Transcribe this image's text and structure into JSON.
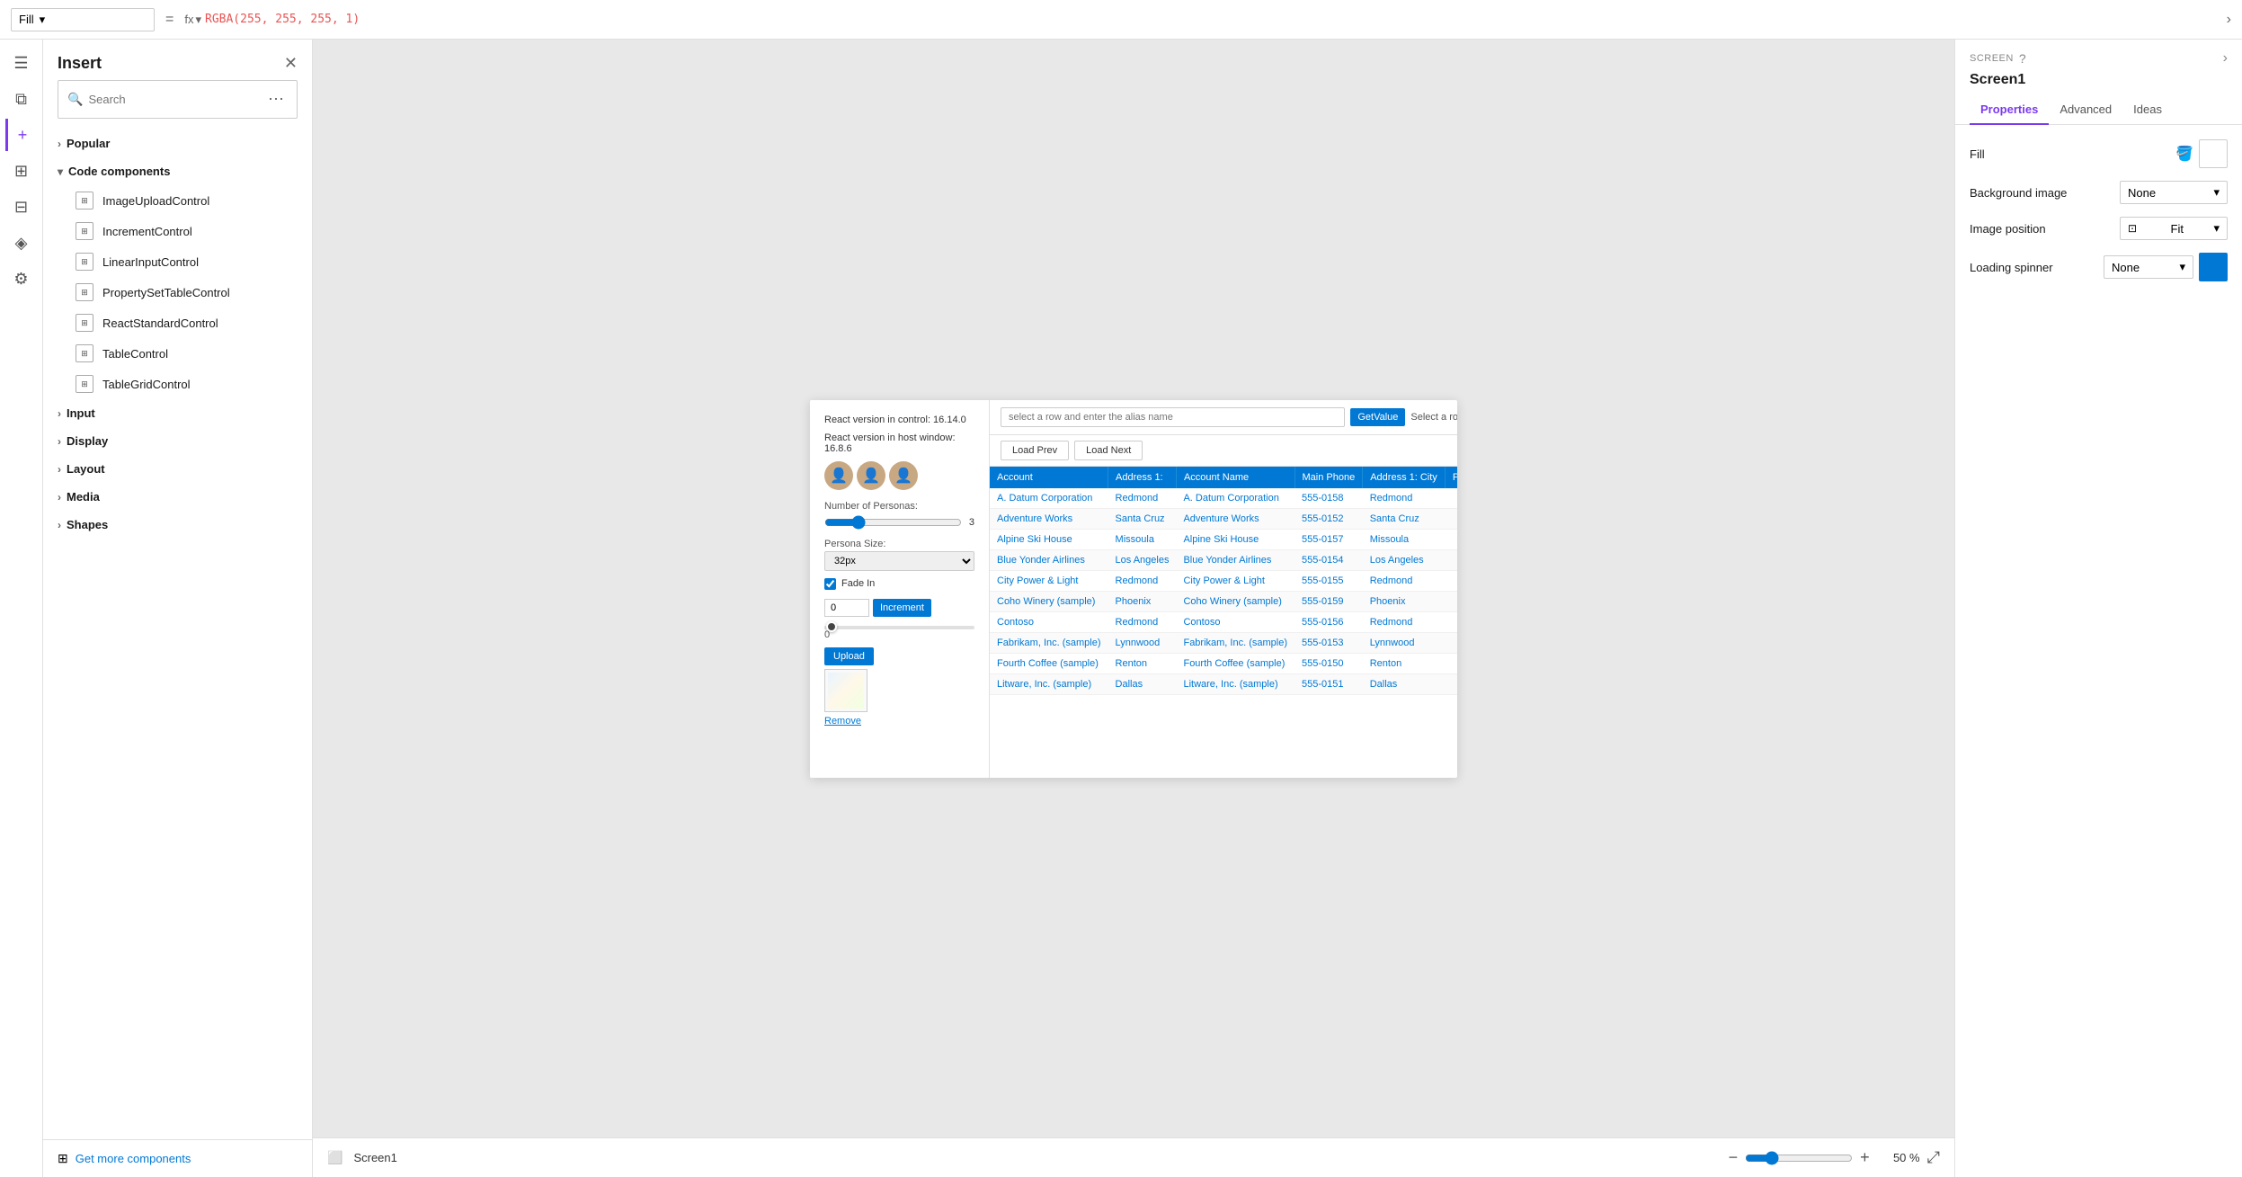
{
  "topbar": {
    "fill_label": "Fill",
    "equals": "=",
    "fx_label": "fx",
    "formula": "RGBA(255, 255, 255, 1)",
    "formula_parts": {
      "func": "RGBA(",
      "args": "255, 255, 255, 1",
      "close": ")"
    }
  },
  "sidebar_icons": [
    {
      "id": "hamburger",
      "symbol": "☰",
      "active": false
    },
    {
      "id": "layers",
      "symbol": "⧉",
      "active": false
    },
    {
      "id": "add",
      "symbol": "+",
      "active": true
    },
    {
      "id": "database",
      "symbol": "⊞",
      "active": false
    },
    {
      "id": "grid",
      "symbol": "⊟",
      "active": false
    },
    {
      "id": "code",
      "symbol": "◈",
      "active": false
    },
    {
      "id": "settings",
      "symbol": "◎",
      "active": false
    }
  ],
  "insert_panel": {
    "title": "Insert",
    "search_placeholder": "Search",
    "sections": [
      {
        "id": "popular",
        "label": "Popular",
        "expanded": false,
        "items": []
      },
      {
        "id": "code-components",
        "label": "Code components",
        "expanded": true,
        "items": [
          {
            "label": "ImageUploadControl"
          },
          {
            "label": "IncrementControl"
          },
          {
            "label": "LinearInputControl"
          },
          {
            "label": "PropertySetTableControl"
          },
          {
            "label": "ReactStandardControl"
          },
          {
            "label": "TableControl"
          },
          {
            "label": "TableGridControl"
          }
        ]
      },
      {
        "id": "input",
        "label": "Input",
        "expanded": false,
        "items": []
      },
      {
        "id": "display",
        "label": "Display",
        "expanded": false,
        "items": []
      },
      {
        "id": "layout",
        "label": "Layout",
        "expanded": false,
        "items": []
      },
      {
        "id": "media",
        "label": "Media",
        "expanded": false,
        "items": []
      },
      {
        "id": "shapes",
        "label": "Shapes",
        "expanded": false,
        "items": []
      }
    ],
    "footer_label": "Get more components"
  },
  "preview": {
    "left_panel": {
      "version_react": "React version in control: 16.14.0",
      "version_host": "React version in host window: 16.8.6",
      "personas_label": "Number of Personas:",
      "persona_value": "3",
      "persona_size_label": "Persona Size:",
      "persona_size_value": "32px",
      "fade_in_label": "Fade In",
      "increment_value": "0",
      "increment_btn": "Increment",
      "progress_value": "0",
      "upload_btn": "Upload",
      "remove_btn": "Remove"
    },
    "right_panel": {
      "alias_placeholder": "select a row and enter the alias name",
      "get_value_btn": "GetValue",
      "select_row_msg": "Select a row first",
      "load_prev_btn": "Load Prev",
      "load_next_btn": "Load Next",
      "table_headers": [
        "Account",
        "Address 1:",
        "Account Name",
        "Main Phone",
        "Address 1: City",
        "Prima..."
      ],
      "table_rows": [
        {
          "account": "A. Datum Corporation",
          "address": "Redmond",
          "account_name": "A. Datum Corporation",
          "phone": "555-0158",
          "city": "Redmond"
        },
        {
          "account": "Adventure Works",
          "address": "Santa Cruz",
          "account_name": "Adventure Works",
          "phone": "555-0152",
          "city": "Santa Cruz"
        },
        {
          "account": "Alpine Ski House",
          "address": "Missoula",
          "account_name": "Alpine Ski House",
          "phone": "555-0157",
          "city": "Missoula"
        },
        {
          "account": "Blue Yonder Airlines",
          "address": "Los Angeles",
          "account_name": "Blue Yonder Airlines",
          "phone": "555-0154",
          "city": "Los Angeles"
        },
        {
          "account": "City Power & Light",
          "address": "Redmond",
          "account_name": "City Power & Light",
          "phone": "555-0155",
          "city": "Redmond"
        },
        {
          "account": "Coho Winery (sample)",
          "address": "Phoenix",
          "account_name": "Coho Winery (sample)",
          "phone": "555-0159",
          "city": "Phoenix"
        },
        {
          "account": "Contoso",
          "address": "Redmond",
          "account_name": "Contoso",
          "phone": "555-0156",
          "city": "Redmond"
        },
        {
          "account": "Fabrikam, Inc. (sample)",
          "address": "Lynnwood",
          "account_name": "Fabrikam, Inc. (sample)",
          "phone": "555-0153",
          "city": "Lynnwood"
        },
        {
          "account": "Fourth Coffee (sample)",
          "address": "Renton",
          "account_name": "Fourth Coffee (sample)",
          "phone": "555-0150",
          "city": "Renton"
        },
        {
          "account": "Litware, Inc. (sample)",
          "address": "Dallas",
          "account_name": "Litware, Inc. (sample)",
          "phone": "555-0151",
          "city": "Dallas"
        }
      ]
    }
  },
  "bottom_bar": {
    "screen_label": "Screen1",
    "zoom_value": "50",
    "zoom_pct": "50 %"
  },
  "properties_panel": {
    "screen_label": "SCREEN",
    "title": "Screen1",
    "tabs": [
      {
        "id": "properties",
        "label": "Properties",
        "active": true
      },
      {
        "id": "advanced",
        "label": "Advanced",
        "active": false
      },
      {
        "id": "ideas",
        "label": "Ideas",
        "active": false
      }
    ],
    "fill_label": "Fill",
    "background_image_label": "Background image",
    "background_image_value": "None",
    "image_position_label": "Image position",
    "image_position_value": "Fit",
    "loading_spinner_label": "Loading spinner",
    "loading_spinner_value": "None"
  }
}
